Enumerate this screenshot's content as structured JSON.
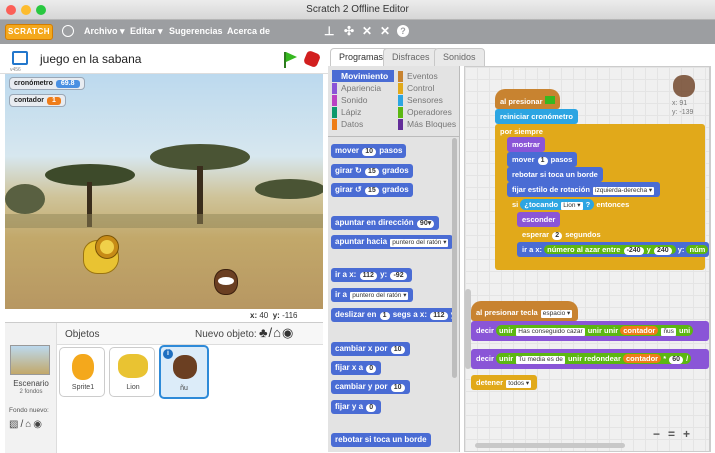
{
  "window": {
    "title": "Scratch 2 Offline Editor"
  },
  "menu": {
    "logo": "SCRATCH",
    "items": [
      "Archivo ▾",
      "Editar ▾",
      "Sugerencias",
      "Acerca de"
    ]
  },
  "toolbar": {
    "icons": [
      "copy-icon",
      "cut-icon",
      "grow-icon",
      "shrink-icon",
      "help-icon"
    ]
  },
  "stage": {
    "project_name": "juego en la sabana",
    "version": "v456",
    "monitors": [
      {
        "label": "cronómetro",
        "value": "69.8",
        "color": "#4a90e2"
      },
      {
        "label": "contador",
        "value": "1",
        "color": "#ef7d1a"
      }
    ],
    "coords": {
      "x_label": "x:",
      "x": "40",
      "y_label": "y:",
      "y": "-116"
    }
  },
  "sprites": {
    "header": "Objetos",
    "new_sprite": "Nuevo objeto:",
    "stage_label": "Escenario",
    "stage_sub": "2 fondos",
    "new_backdrop": "Fondo nuevo:",
    "items": [
      {
        "name": "Sprite1"
      },
      {
        "name": "Lion"
      },
      {
        "name": "ñu"
      }
    ]
  },
  "tabs": [
    "Programas",
    "Disfraces",
    "Sonidos"
  ],
  "categories": [
    {
      "name": "Movimiento",
      "color": "#4a6cd4",
      "active": true
    },
    {
      "name": "Apariencia",
      "color": "#8a55d7"
    },
    {
      "name": "Sonido",
      "color": "#bb42c3"
    },
    {
      "name": "Lápiz",
      "color": "#0e9a6c"
    },
    {
      "name": "Datos",
      "color": "#ee7d16"
    },
    {
      "name": "Eventos",
      "color": "#c88330"
    },
    {
      "name": "Control",
      "color": "#e1a91a"
    },
    {
      "name": "Sensores",
      "color": "#2ca5e2"
    },
    {
      "name": "Operadores",
      "color": "#5cb712"
    },
    {
      "name": "Más Bloques",
      "color": "#632d99"
    }
  ],
  "palette": {
    "move": [
      "mover",
      "10",
      "pasos"
    ],
    "turn_r": [
      "girar ↻",
      "15",
      "grados"
    ],
    "turn_l": [
      "girar ↺",
      "15",
      "grados"
    ],
    "point_dir": [
      "apuntar en dirección",
      "90▾"
    ],
    "point_to": [
      "apuntar hacia",
      "puntero del ratón ▾"
    ],
    "goto_xy": [
      "ir a x:",
      "112",
      "y:",
      "-92"
    ],
    "goto": [
      "ir a",
      "puntero del ratón ▾"
    ],
    "glide": [
      "deslizar en",
      "1",
      "segs a x:",
      "112",
      "y:"
    ],
    "change_x": [
      "cambiar x por",
      "10"
    ],
    "set_x": [
      "fijar x a",
      "0"
    ],
    "change_y": [
      "cambiar y por",
      "10"
    ],
    "set_y": [
      "fijar y a",
      "0"
    ],
    "bounce": "rebotar si toca un borde"
  },
  "script1": {
    "hat": "al presionar",
    "reset": "reiniciar cronómetro",
    "forever": "por siempre",
    "show": "mostrar",
    "move": [
      "mover",
      "1",
      "pasos"
    ],
    "bounce": "rebotar si toca un borde",
    "rotation": [
      "fijar estilo de rotación",
      "izquierda-derecha ▾"
    ],
    "if": [
      "si",
      "¿tocando",
      "Lion ▾",
      "?",
      "entonces"
    ],
    "hide": "esconder",
    "wait": [
      "esperar",
      "2",
      "segundos"
    ],
    "goto": [
      "ir a x:",
      "número al azar entre",
      "-240",
      "y",
      "240",
      "y:",
      "núm"
    ]
  },
  "script2": {
    "hat": [
      "al presionar tecla",
      "espacio ▾"
    ],
    "say1": [
      "decir",
      "unir",
      "Has conseguido cazar",
      "unir",
      "unir",
      "contador",
      "ñus",
      "uni"
    ],
    "say2": [
      "decir",
      "unir",
      "Tu media es de",
      "unir",
      "redondear",
      "contador",
      "*",
      "60",
      "/"
    ],
    "stop": [
      "detener",
      "todos ▾"
    ]
  },
  "sprite_info": {
    "x": "x: 91",
    "y": "y: -139"
  },
  "zoom": {
    "out": "−",
    "reset": "=",
    "in": "+"
  }
}
